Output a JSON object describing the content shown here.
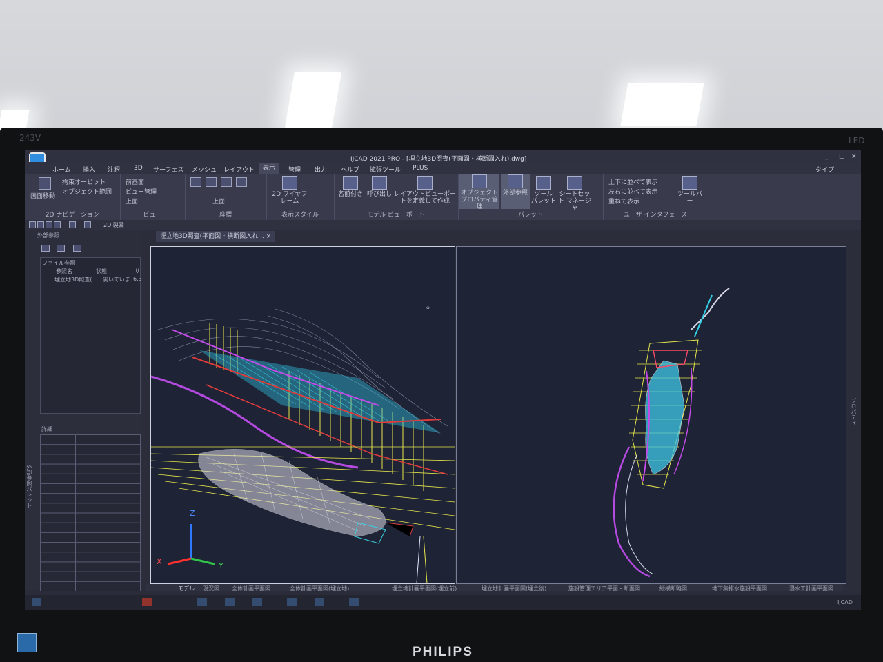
{
  "bezel": {
    "model": "243V",
    "led": "LED",
    "brand": "PHILIPS"
  },
  "window": {
    "title": "IJCAD 2021 PRO - [埋立地3D照査(平面図・横断図入れ).dwg]",
    "search_label": "タイプ",
    "controls": [
      "_",
      "□",
      "×"
    ]
  },
  "ribbon_tabs": [
    "ホーム",
    "挿入",
    "注釈",
    "3D",
    "サーフェス",
    "メッシュ",
    "レイアウト",
    "表示",
    "管理",
    "出力",
    "ヘルプ",
    "拡張ツール",
    "PLUS"
  ],
  "active_tab": "表示",
  "ribbon": {
    "nav2d": {
      "pan": "画面移動",
      "orbit": "拘束オービット",
      "extents": "オブジェクト範囲",
      "label": "2D ナビゲーション"
    },
    "view": {
      "prev": "前画面",
      "manager": "ビュー管理",
      "top": "上面",
      "label": "ビュー"
    },
    "coords": {
      "top": "上面",
      "label": "座標"
    },
    "style": {
      "wire": "2D ワイヤフレーム",
      "label": "表示スタイル"
    },
    "viewport": {
      "named": "名前付き",
      "restore": "呼び出し",
      "create": "レイアウトビューポートを定義して作成",
      "label": "モデル ビューポート"
    },
    "palette": {
      "objprop": "オブジェクト プロパティ管理",
      "xref": "外部参照",
      "tool": "ツール パレット",
      "sheetset": "シートセット マネージャ",
      "label": "パレット"
    },
    "ui": {
      "tile_h": "上下に並べて表示",
      "tile_v": "左右に並べて表示",
      "cascade": "重ねて表示",
      "toolbar": "ツールバー",
      "label": "ユーザ インタフェース"
    }
  },
  "qat": {
    "workspace": "2D 製図"
  },
  "xref_panel": {
    "title": "外部参照",
    "file_ref": "ファイル参照",
    "columns": [
      "参照名",
      "状態",
      "サ"
    ],
    "rows": [
      {
        "name": "埋立地3D照査(...",
        "status": "開いていま...",
        "size": "6.3"
      }
    ],
    "details": "詳細",
    "side_tab": "外部参照パレット"
  },
  "doc_tab": "埋立地3D照査(平面図・横断図入れ...",
  "axes": {
    "z": "Z",
    "x": "X",
    "y": "Y"
  },
  "right_side_tab": "プロパティ",
  "layout_tabs": [
    "モデル",
    "現況図",
    "全体計画平面図",
    "全体計画平面図(埋立地)",
    "埋立地計画平面図(埋立前)",
    "埋立地計画平面図(埋立後)",
    "施設管理エリア平面・断面図",
    "縦横断略図",
    "地下集排水施設平面図",
    "浸水工計画平面図"
  ],
  "tray": {
    "app": "IJCAD"
  },
  "colors": {
    "model_bg": "#1e2336",
    "accent": "#5a5e74"
  }
}
